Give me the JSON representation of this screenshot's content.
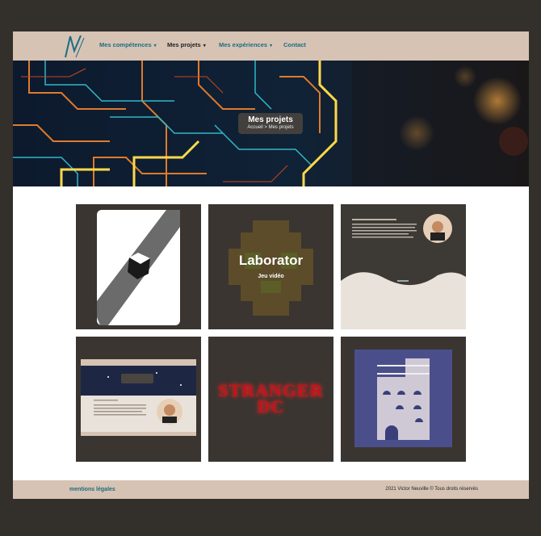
{
  "nav": {
    "items": [
      {
        "label": "Mes compétences"
      },
      {
        "label": "Mes projets"
      },
      {
        "label": "Mes expériences"
      },
      {
        "label": "Contact"
      }
    ]
  },
  "hero": {
    "title": "Mes projets",
    "breadcrumb": "Accueil > Mes projets"
  },
  "projects": [
    {
      "title": ""
    },
    {
      "title": "Laborator",
      "subtitle": "Jeu vidéo"
    },
    {
      "title": ""
    },
    {
      "title": ""
    },
    {
      "title": "STRANGER DC"
    },
    {
      "title": ""
    }
  ],
  "footer": {
    "link": "mentions légales",
    "copyright": "2021 Victor Neuville © Tous droits réservés"
  },
  "colors": {
    "nav_bg": "#d6c3b4",
    "accent": "#1d6c80",
    "tile_bg": "#3a3530",
    "page_bg": "#332f2b"
  }
}
